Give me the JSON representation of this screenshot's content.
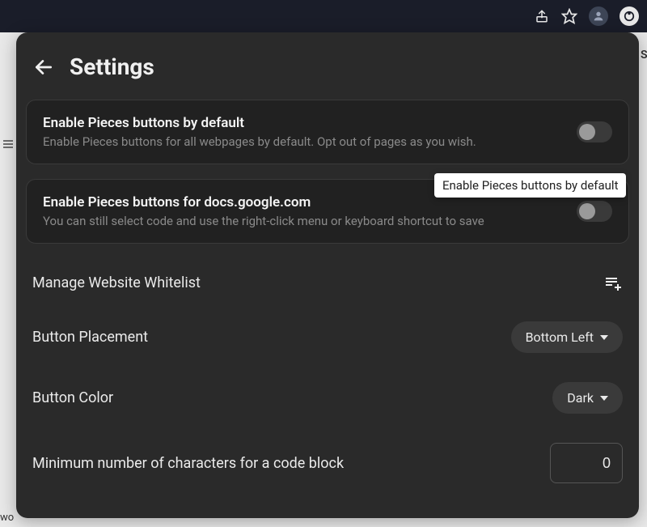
{
  "browser": {
    "icons": [
      "share",
      "star",
      "profile",
      "pieces-extension"
    ]
  },
  "header": {
    "title": "Settings"
  },
  "toggles": [
    {
      "title": "Enable Pieces buttons by default",
      "subtitle": "Enable Pieces buttons for all webpages by default. Opt out of pages as you wish.",
      "checked": false
    },
    {
      "title": "Enable Pieces buttons for docs.google.com",
      "subtitle": "You can still select code and use the right-click menu or keyboard shortcut to save",
      "checked": false
    }
  ],
  "tooltip": "Enable Pieces buttons by default",
  "whitelist": {
    "label": "Manage Website Whitelist"
  },
  "placement": {
    "label": "Button Placement",
    "value": "Bottom Left"
  },
  "color": {
    "label": "Button Color",
    "value": "Dark"
  },
  "minchars": {
    "label": "Minimum number of characters for a code block",
    "value": "0"
  }
}
